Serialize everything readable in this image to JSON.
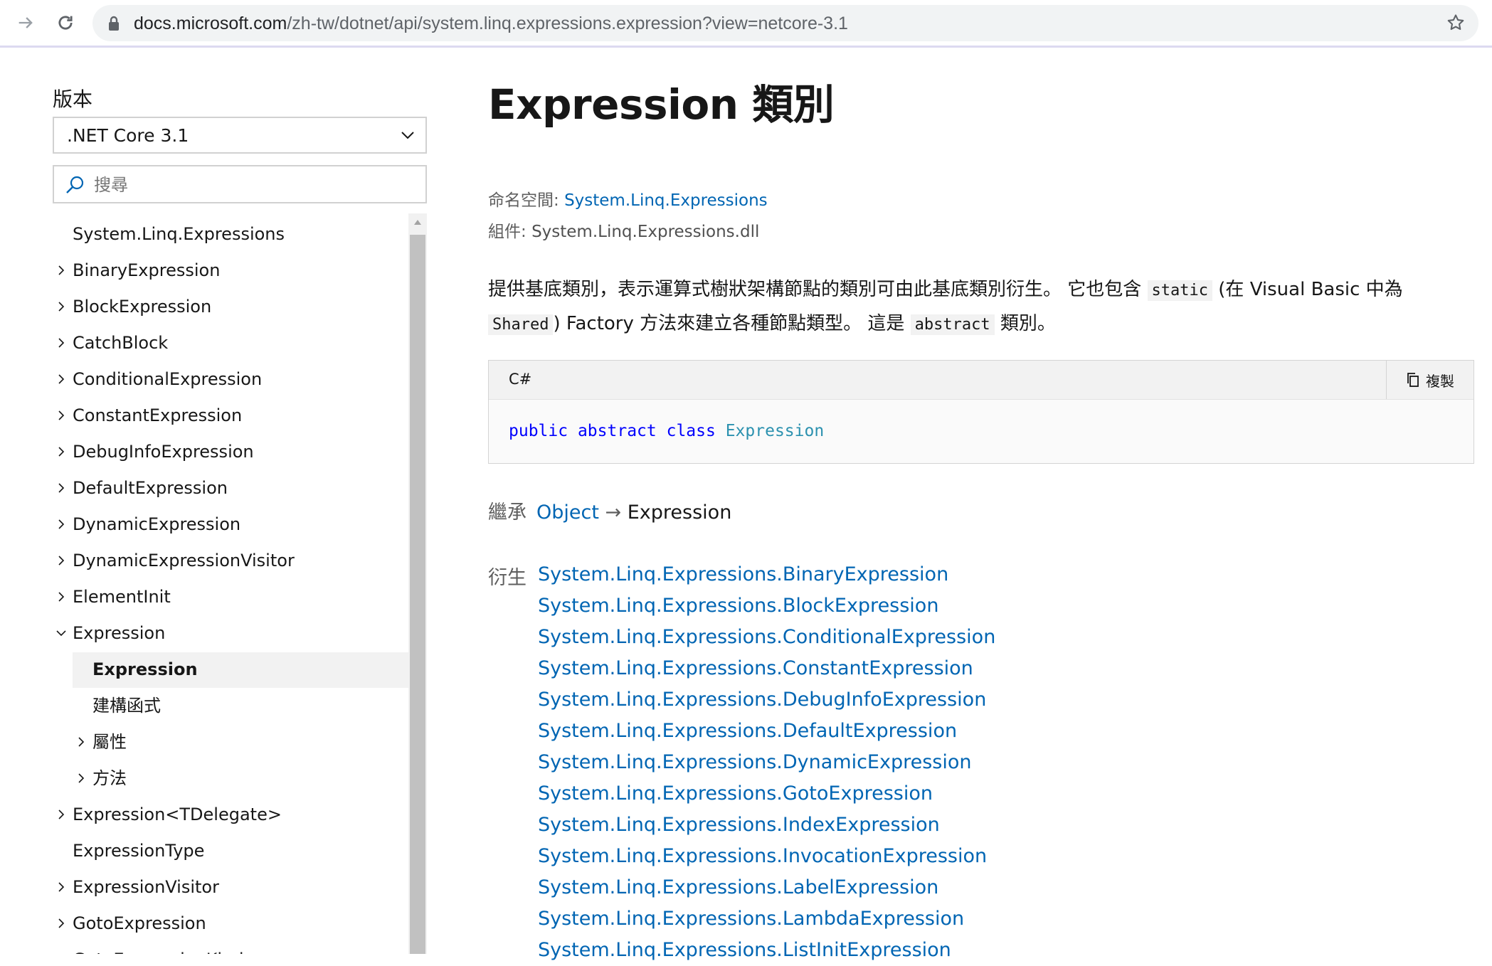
{
  "browser": {
    "url_host": "docs.microsoft.com",
    "url_path": "/zh-tw/dotnet/api/system.linq.expressions.expression?view=netcore-3.1"
  },
  "sidebar": {
    "version_heading": "版本",
    "version_value": ".NET Core 3.1",
    "search_placeholder": "搜尋",
    "toc": [
      {
        "label": "System.Linq.Expressions",
        "level": 0,
        "expandable": false
      },
      {
        "label": "BinaryExpression",
        "level": 0,
        "expandable": true
      },
      {
        "label": "BlockExpression",
        "level": 0,
        "expandable": true
      },
      {
        "label": "CatchBlock",
        "level": 0,
        "expandable": true
      },
      {
        "label": "ConditionalExpression",
        "level": 0,
        "expandable": true
      },
      {
        "label": "ConstantExpression",
        "level": 0,
        "expandable": true
      },
      {
        "label": "DebugInfoExpression",
        "level": 0,
        "expandable": true
      },
      {
        "label": "DefaultExpression",
        "level": 0,
        "expandable": true
      },
      {
        "label": "DynamicExpression",
        "level": 0,
        "expandable": true
      },
      {
        "label": "DynamicExpressionVisitor",
        "level": 0,
        "expandable": true
      },
      {
        "label": "ElementInit",
        "level": 0,
        "expandable": true
      },
      {
        "label": "Expression",
        "level": 0,
        "expandable": true,
        "expanded": true
      },
      {
        "label": "Expression",
        "level": 1,
        "expandable": false,
        "selected": true
      },
      {
        "label": "建構函式",
        "level": 1,
        "expandable": false
      },
      {
        "label": "屬性",
        "level": 1,
        "expandable": true
      },
      {
        "label": "方法",
        "level": 1,
        "expandable": true
      },
      {
        "label": "Expression<TDelegate>",
        "level": 0,
        "expandable": true
      },
      {
        "label": "ExpressionType",
        "level": 0,
        "expandable": false
      },
      {
        "label": "ExpressionVisitor",
        "level": 0,
        "expandable": true
      },
      {
        "label": "GotoExpression",
        "level": 0,
        "expandable": true
      },
      {
        "label": "GotoExpressionKind",
        "level": 0,
        "expandable": false
      }
    ]
  },
  "main": {
    "title": "Expression 類別",
    "namespace_label": "命名空間:",
    "namespace_value": "System.Linq.Expressions",
    "assembly_label": "組件:",
    "assembly_value": "System.Linq.Expressions.dll",
    "summary": {
      "part1": "提供基底類別，表示運算式樹狀架構節點的類別可由此基底類別衍生。 它也包含 ",
      "code1": "static",
      "part2": " (在 Visual Basic 中為 ",
      "code2": "Shared",
      "part3": ") Factory 方法來建立各種節點類型。 這是 ",
      "code3": "abstract",
      "part4": " 類別。"
    },
    "code": {
      "language": "C#",
      "copy_label": "複製",
      "kw1": "public",
      "kw2": "abstract",
      "kw3": "class",
      "type": "Expression"
    },
    "inheritance": {
      "label": "繼承",
      "base": "Object",
      "arrow": "→",
      "current": "Expression"
    },
    "derived": {
      "label": "衍生",
      "items": [
        "System.Linq.Expressions.BinaryExpression",
        "System.Linq.Expressions.BlockExpression",
        "System.Linq.Expressions.ConditionalExpression",
        "System.Linq.Expressions.ConstantExpression",
        "System.Linq.Expressions.DebugInfoExpression",
        "System.Linq.Expressions.DefaultExpression",
        "System.Linq.Expressions.DynamicExpression",
        "System.Linq.Expressions.GotoExpression",
        "System.Linq.Expressions.IndexExpression",
        "System.Linq.Expressions.InvocationExpression",
        "System.Linq.Expressions.LabelExpression",
        "System.Linq.Expressions.LambdaExpression",
        "System.Linq.Expressions.ListInitExpression"
      ]
    }
  },
  "colors": {
    "link": "#0065b3",
    "keyword": "#0101fd",
    "type": "#2b91af",
    "selected_bg": "#f2f2f2"
  }
}
